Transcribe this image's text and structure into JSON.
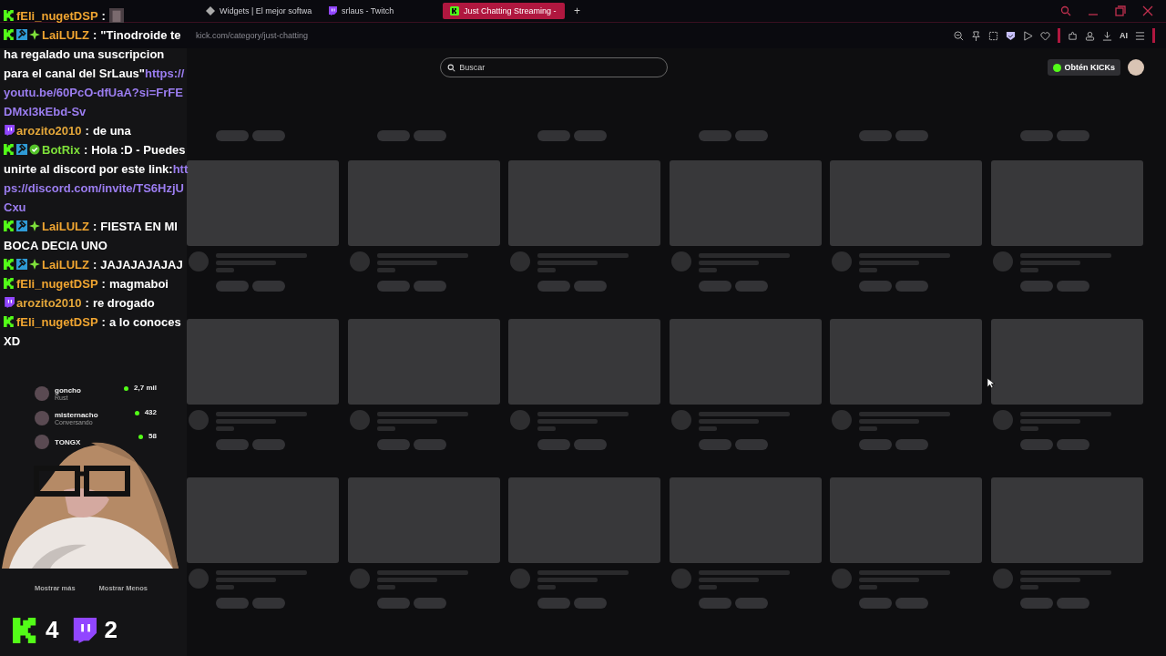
{
  "tabs": [
    {
      "title": "Widgets | El mejor softwa",
      "kind": "widgets",
      "selected": false
    },
    {
      "title": "srlaus - Twitch",
      "kind": "twitch",
      "selected": false
    },
    {
      "title": "Just Chatting Streaming -",
      "kind": "kick",
      "selected": true
    }
  ],
  "new_tab": "+",
  "address": "kick.com/category/just-chatting",
  "toolbar_ai": "AI",
  "search": {
    "placeholder": "Buscar"
  },
  "get_kicks": "Obtén KICKs",
  "sidebar": {
    "channels": [
      {
        "name": "goncho",
        "category": "Rust",
        "viewers": "2,7 mil"
      },
      {
        "name": "misternacho",
        "category": "Conversando",
        "viewers": "432"
      },
      {
        "name": "TONGX",
        "viewers": "58"
      }
    ],
    "show_more": "Mostrar más",
    "show_less": "Mostrar Menos"
  },
  "chat": [
    {
      "badges": [
        {
          "kind": "kick"
        }
      ],
      "user": "fEli_nugetDSP",
      "color": "#f0a531",
      "sep": ":",
      "kind": "emote"
    },
    {
      "badges": [
        {
          "kind": "kick"
        },
        {
          "kind": "mod"
        },
        {
          "kind": "vip"
        }
      ],
      "user": "LaiLULZ",
      "color": "#f0a531",
      "sep": ":",
      "kind": "text",
      "text": "\"Tinodroide te ha regalado una suscripcion para el canal del SrLaus\"",
      "link": "https://youtu.be/60PcO-dfUaA?si=FrFEDMxl3kEbd-Sv"
    },
    {
      "badges": [
        {
          "kind": "twitch"
        }
      ],
      "user": "arozito2010",
      "color": "#e3a63a",
      "sep": ":",
      "kind": "text",
      "text": "de una"
    },
    {
      "badges": [
        {
          "kind": "kick"
        },
        {
          "kind": "mod"
        },
        {
          "kind": "verified"
        }
      ],
      "user": "BotRix",
      "color": "#7ee03a",
      "sep": ":",
      "kind": "text",
      "text": "Hola :D - Puedes unirte al discord por este link:",
      "link": "https://discord.com/invite/TS6HzjUCxu"
    },
    {
      "badges": [
        {
          "kind": "kick"
        },
        {
          "kind": "mod"
        },
        {
          "kind": "vip"
        }
      ],
      "user": "LaiLULZ",
      "color": "#f0a531",
      "sep": ":",
      "kind": "text",
      "text": "FIESTA EN MI BOCA DECIA UNO"
    },
    {
      "badges": [
        {
          "kind": "kick"
        },
        {
          "kind": "mod"
        },
        {
          "kind": "vip"
        }
      ],
      "user": "LaiLULZ",
      "color": "#f0a531",
      "sep": ":",
      "kind": "text",
      "text": "JAJAJAJAJAJ"
    },
    {
      "badges": [
        {
          "kind": "kick"
        }
      ],
      "user": "fEli_nugetDSP",
      "color": "#f0a531",
      "sep": ":",
      "kind": "text",
      "text": "magmaboi"
    },
    {
      "badges": [
        {
          "kind": "twitch"
        }
      ],
      "user": "arozito2010",
      "color": "#e3a63a",
      "sep": ":",
      "kind": "text",
      "text": "re drogado"
    },
    {
      "badges": [
        {
          "kind": "kick"
        }
      ],
      "user": "fEli_nugetDSP",
      "color": "#f0a531",
      "sep": ":",
      "kind": "text",
      "text": "a lo conoces XD"
    }
  ],
  "viewer_counts": [
    {
      "kind": "kick",
      "count": "4"
    },
    {
      "kind": "twitch",
      "count": "2"
    }
  ]
}
